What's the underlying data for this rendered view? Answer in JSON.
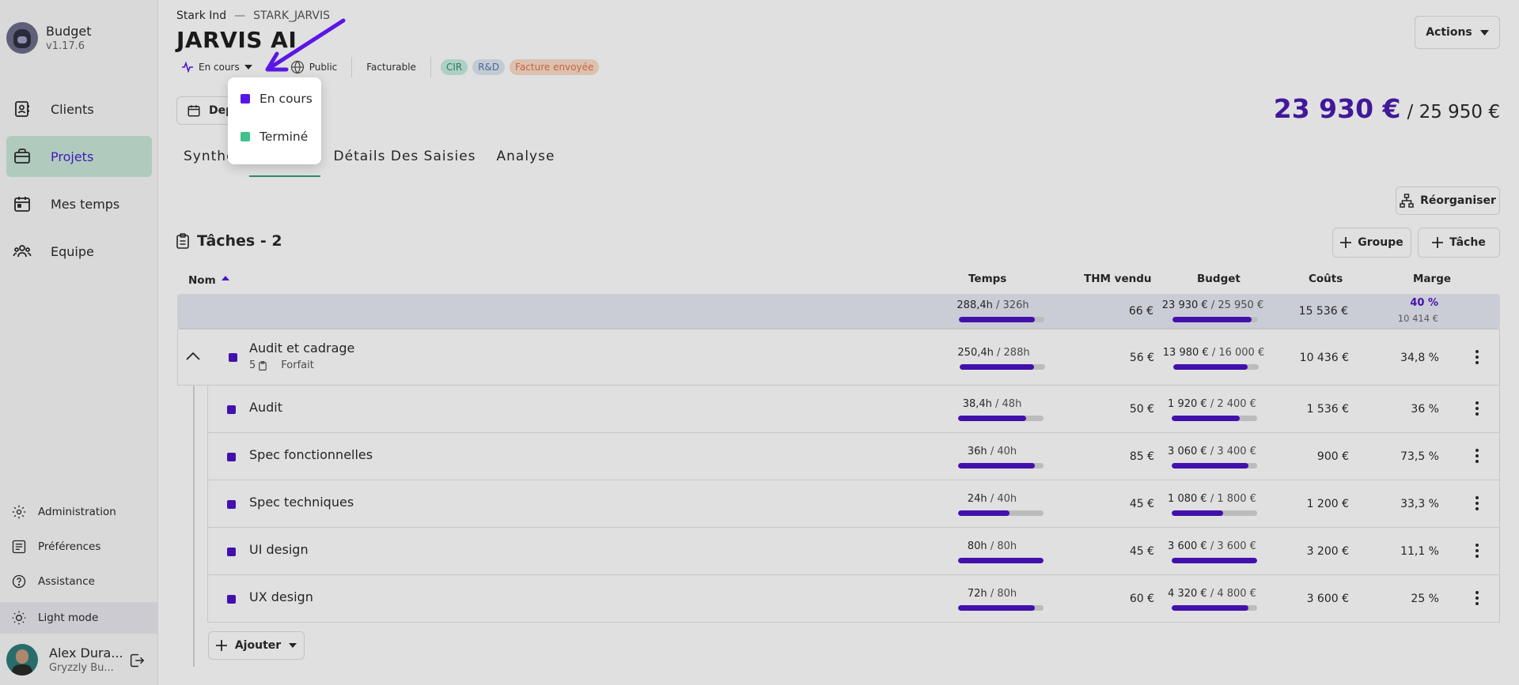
{
  "app": {
    "name": "Budget",
    "version": "v1.17.6"
  },
  "sidebar": {
    "items": [
      {
        "label": "Clients",
        "icon": "contacts-icon"
      },
      {
        "label": "Projets",
        "icon": "briefcase-icon",
        "active": true
      },
      {
        "label": "Mes temps",
        "icon": "calendar-icon"
      },
      {
        "label": "Equipe",
        "icon": "team-icon"
      }
    ],
    "bottom": [
      {
        "label": "Administration",
        "icon": "gear-icon"
      },
      {
        "label": "Préférences",
        "icon": "sliders-icon"
      },
      {
        "label": "Assistance",
        "icon": "help-icon"
      },
      {
        "label": "Light mode",
        "icon": "sun-icon"
      }
    ],
    "user": {
      "name": "Alex Dura...",
      "org": "Gryzzly Bu..."
    }
  },
  "header": {
    "client": "Stark Ind",
    "separator": "—",
    "project_code": "STARK_JARVIS",
    "title": "JARVIS AI",
    "status": "En cours",
    "visibility": "Public",
    "billing": "Facturable",
    "tags": [
      "CIR",
      "R&D",
      "Facture envoyée"
    ],
    "actions_label": "Actions",
    "dep_label": "Dep",
    "budget_spent": "23 930 €",
    "budget_total": "/ 25 950 €"
  },
  "status_dropdown": {
    "options": [
      {
        "label": "En cours",
        "color": "#5a16e6"
      },
      {
        "label": "Terminé",
        "color": "#3fc38a"
      }
    ]
  },
  "tabs": [
    {
      "label": "Synthè"
    },
    {
      "label": "",
      "active": true
    },
    {
      "label": "Détails Des Saisies"
    },
    {
      "label": "Analyse"
    }
  ],
  "toolbar": {
    "reorganize": "Réorganiser",
    "group": "Groupe",
    "task": "Tâche",
    "add": "Ajouter"
  },
  "tasks": {
    "title": "Tâches - 2",
    "columns": {
      "name": "Nom",
      "time": "Temps",
      "thm": "THM vendu",
      "budget": "Budget",
      "costs": "Coûts",
      "margin": "Marge"
    },
    "total": {
      "time_used": "288,4h",
      "time_total": "/ 326h",
      "time_pct": 0.885,
      "thm": "66 €",
      "budget_used": "23 930 €",
      "budget_total": "/ 25 950 €",
      "budget_pct": 0.922,
      "costs": "15 536 €",
      "margin_pct": "40 %",
      "margin_val": "10 414 €"
    },
    "group": {
      "name": "Audit et cadrage",
      "count": "5",
      "type": "Forfait",
      "time_used": "250,4h",
      "time_total": "/ 288h",
      "time_pct": 0.87,
      "thm": "56 €",
      "budget_used": "13 980 €",
      "budget_total": "/ 16 000 €",
      "budget_pct": 0.874,
      "costs": "10 436 €",
      "margin": "34,8 %"
    },
    "rows": [
      {
        "name": "Audit",
        "time_used": "38,4h",
        "time_total": "/ 48h",
        "time_pct": 0.8,
        "thm": "50 €",
        "budget_used": "1 920 €",
        "budget_total": "/ 2 400 €",
        "budget_pct": 0.8,
        "costs": "1 536 €",
        "margin": "36 %"
      },
      {
        "name": "Spec fonctionnelles",
        "time_used": "36h",
        "time_total": "/ 40h",
        "time_pct": 0.9,
        "thm": "85 €",
        "budget_used": "3 060 €",
        "budget_total": "/ 3 400 €",
        "budget_pct": 0.9,
        "costs": "900 €",
        "margin": "73,5 %"
      },
      {
        "name": "Spec techniques",
        "time_used": "24h",
        "time_total": "/ 40h",
        "time_pct": 0.6,
        "thm": "45 €",
        "budget_used": "1 080 €",
        "budget_total": "/ 1 800 €",
        "budget_pct": 0.6,
        "costs": "1 200 €",
        "margin": "33,3 %"
      },
      {
        "name": "UI design",
        "time_used": "80h",
        "time_total": "/ 80h",
        "time_pct": 1.0,
        "thm": "45 €",
        "budget_used": "3 600 €",
        "budget_total": "/ 3 600 €",
        "budget_pct": 1.0,
        "costs": "3 200 €",
        "margin": "11,1 %"
      },
      {
        "name": "UX design",
        "time_used": "72h",
        "time_total": "/ 80h",
        "time_pct": 0.9,
        "thm": "60 €",
        "budget_used": "4 320 €",
        "budget_total": "/ 4 800 €",
        "budget_pct": 0.9,
        "costs": "3 600 €",
        "margin": "25 %"
      }
    ]
  },
  "colors": {
    "accent": "#4c14c4",
    "active_nav_bg": "#c9e8d9",
    "done": "#3fc38a"
  }
}
